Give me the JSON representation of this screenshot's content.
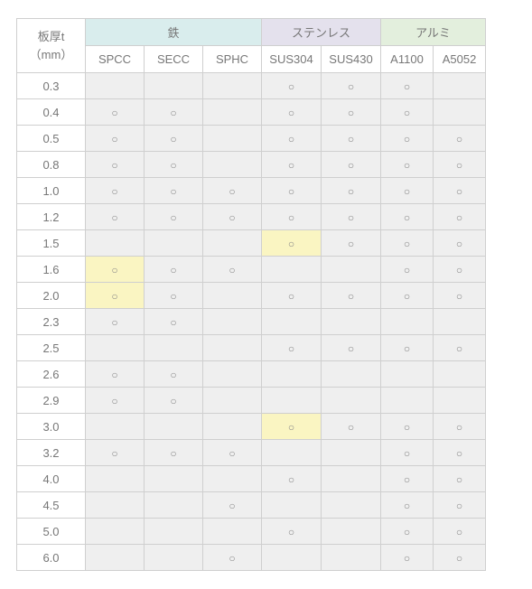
{
  "header": {
    "row_label_line1": "板厚t",
    "row_label_line2": "（mm）",
    "groups": [
      {
        "label": "鉄",
        "class": "grp-iron",
        "cols": [
          "SPCC",
          "SECC",
          "SPHC"
        ]
      },
      {
        "label": "ステンレス",
        "class": "grp-sus",
        "cols": [
          "SUS304",
          "SUS430"
        ]
      },
      {
        "label": "アルミ",
        "class": "grp-al",
        "cols": [
          "A1100",
          "A5052"
        ]
      }
    ]
  },
  "mark": "○",
  "rows": [
    {
      "t": "0.3",
      "cells": [
        null,
        null,
        null,
        "○",
        "○",
        "○",
        null
      ]
    },
    {
      "t": "0.4",
      "cells": [
        "○",
        "○",
        null,
        "○",
        "○",
        "○",
        null
      ]
    },
    {
      "t": "0.5",
      "cells": [
        "○",
        "○",
        null,
        "○",
        "○",
        "○",
        "○"
      ]
    },
    {
      "t": "0.8",
      "cells": [
        "○",
        "○",
        null,
        "○",
        "○",
        "○",
        "○"
      ]
    },
    {
      "t": "1.0",
      "cells": [
        "○",
        "○",
        "○",
        "○",
        "○",
        "○",
        "○"
      ]
    },
    {
      "t": "1.2",
      "cells": [
        "○",
        "○",
        "○",
        "○",
        "○",
        "○",
        "○"
      ]
    },
    {
      "t": "1.5",
      "cells": [
        null,
        null,
        null,
        "○",
        "○",
        "○",
        "○"
      ],
      "hl": [
        3
      ]
    },
    {
      "t": "1.6",
      "cells": [
        "○",
        "○",
        "○",
        null,
        null,
        "○",
        "○"
      ],
      "hl": [
        0
      ]
    },
    {
      "t": "2.0",
      "cells": [
        "○",
        "○",
        null,
        "○",
        "○",
        "○",
        "○"
      ],
      "hl": [
        0
      ]
    },
    {
      "t": "2.3",
      "cells": [
        "○",
        "○",
        null,
        null,
        null,
        null,
        null
      ]
    },
    {
      "t": "2.5",
      "cells": [
        null,
        null,
        null,
        "○",
        "○",
        "○",
        "○"
      ]
    },
    {
      "t": "2.6",
      "cells": [
        "○",
        "○",
        null,
        null,
        null,
        null,
        null
      ]
    },
    {
      "t": "2.9",
      "cells": [
        "○",
        "○",
        null,
        null,
        null,
        null,
        null
      ]
    },
    {
      "t": "3.0",
      "cells": [
        null,
        null,
        null,
        "○",
        "○",
        "○",
        "○"
      ],
      "hl": [
        3
      ]
    },
    {
      "t": "3.2",
      "cells": [
        "○",
        "○",
        "○",
        null,
        null,
        "○",
        "○"
      ]
    },
    {
      "t": "4.0",
      "cells": [
        null,
        null,
        null,
        "○",
        null,
        "○",
        "○"
      ]
    },
    {
      "t": "4.5",
      "cells": [
        null,
        null,
        "○",
        null,
        null,
        "○",
        "○"
      ]
    },
    {
      "t": "5.0",
      "cells": [
        null,
        null,
        null,
        "○",
        null,
        "○",
        "○"
      ]
    },
    {
      "t": "6.0",
      "cells": [
        null,
        null,
        "○",
        null,
        null,
        "○",
        "○"
      ]
    }
  ],
  "chart_data": {
    "type": "table",
    "row_dimension": "板厚t (mm)",
    "columns": [
      "SPCC",
      "SECC",
      "SPHC",
      "SUS304",
      "SUS430",
      "A1100",
      "A5052"
    ],
    "column_groups": {
      "鉄": [
        "SPCC",
        "SECC",
        "SPHC"
      ],
      "ステンレス": [
        "SUS304",
        "SUS430"
      ],
      "アルミ": [
        "A1100",
        "A5052"
      ]
    },
    "thicknesses": [
      0.3,
      0.4,
      0.5,
      0.8,
      1.0,
      1.2,
      1.5,
      1.6,
      2.0,
      2.3,
      2.5,
      2.6,
      2.9,
      3.0,
      3.2,
      4.0,
      4.5,
      5.0,
      6.0
    ],
    "availability": {
      "0.3": {
        "SPCC": 0,
        "SECC": 0,
        "SPHC": 0,
        "SUS304": 1,
        "SUS430": 1,
        "A1100": 1,
        "A5052": 0
      },
      "0.4": {
        "SPCC": 1,
        "SECC": 1,
        "SPHC": 0,
        "SUS304": 1,
        "SUS430": 1,
        "A1100": 1,
        "A5052": 0
      },
      "0.5": {
        "SPCC": 1,
        "SECC": 1,
        "SPHC": 0,
        "SUS304": 1,
        "SUS430": 1,
        "A1100": 1,
        "A5052": 1
      },
      "0.8": {
        "SPCC": 1,
        "SECC": 1,
        "SPHC": 0,
        "SUS304": 1,
        "SUS430": 1,
        "A1100": 1,
        "A5052": 1
      },
      "1.0": {
        "SPCC": 1,
        "SECC": 1,
        "SPHC": 1,
        "SUS304": 1,
        "SUS430": 1,
        "A1100": 1,
        "A5052": 1
      },
      "1.2": {
        "SPCC": 1,
        "SECC": 1,
        "SPHC": 1,
        "SUS304": 1,
        "SUS430": 1,
        "A1100": 1,
        "A5052": 1
      },
      "1.5": {
        "SPCC": 0,
        "SECC": 0,
        "SPHC": 0,
        "SUS304": 1,
        "SUS430": 1,
        "A1100": 1,
        "A5052": 1
      },
      "1.6": {
        "SPCC": 1,
        "SECC": 1,
        "SPHC": 1,
        "SUS304": 0,
        "SUS430": 0,
        "A1100": 1,
        "A5052": 1
      },
      "2.0": {
        "SPCC": 1,
        "SECC": 1,
        "SPHC": 0,
        "SUS304": 1,
        "SUS430": 1,
        "A1100": 1,
        "A5052": 1
      },
      "2.3": {
        "SPCC": 1,
        "SECC": 1,
        "SPHC": 0,
        "SUS304": 0,
        "SUS430": 0,
        "A1100": 0,
        "A5052": 0
      },
      "2.5": {
        "SPCC": 0,
        "SECC": 0,
        "SPHC": 0,
        "SUS304": 1,
        "SUS430": 1,
        "A1100": 1,
        "A5052": 1
      },
      "2.6": {
        "SPCC": 1,
        "SECC": 1,
        "SPHC": 0,
        "SUS304": 0,
        "SUS430": 0,
        "A1100": 0,
        "A5052": 0
      },
      "2.9": {
        "SPCC": 1,
        "SECC": 1,
        "SPHC": 0,
        "SUS304": 0,
        "SUS430": 0,
        "A1100": 0,
        "A5052": 0
      },
      "3.0": {
        "SPCC": 0,
        "SECC": 0,
        "SPHC": 0,
        "SUS304": 1,
        "SUS430": 1,
        "A1100": 1,
        "A5052": 1
      },
      "3.2": {
        "SPCC": 1,
        "SECC": 1,
        "SPHC": 1,
        "SUS304": 0,
        "SUS430": 0,
        "A1100": 1,
        "A5052": 1
      },
      "4.0": {
        "SPCC": 0,
        "SECC": 0,
        "SPHC": 0,
        "SUS304": 1,
        "SUS430": 0,
        "A1100": 1,
        "A5052": 1
      },
      "4.5": {
        "SPCC": 0,
        "SECC": 0,
        "SPHC": 1,
        "SUS304": 0,
        "SUS430": 0,
        "A1100": 1,
        "A5052": 1
      },
      "5.0": {
        "SPCC": 0,
        "SECC": 0,
        "SPHC": 0,
        "SUS304": 1,
        "SUS430": 0,
        "A1100": 1,
        "A5052": 1
      },
      "6.0": {
        "SPCC": 0,
        "SECC": 0,
        "SPHC": 1,
        "SUS304": 0,
        "SUS430": 0,
        "A1100": 1,
        "A5052": 1
      }
    },
    "highlighted_cells": [
      {
        "t": 1.5,
        "col": "SUS304"
      },
      {
        "t": 1.6,
        "col": "SPCC"
      },
      {
        "t": 2.0,
        "col": "SPCC"
      },
      {
        "t": 3.0,
        "col": "SUS304"
      }
    ]
  }
}
